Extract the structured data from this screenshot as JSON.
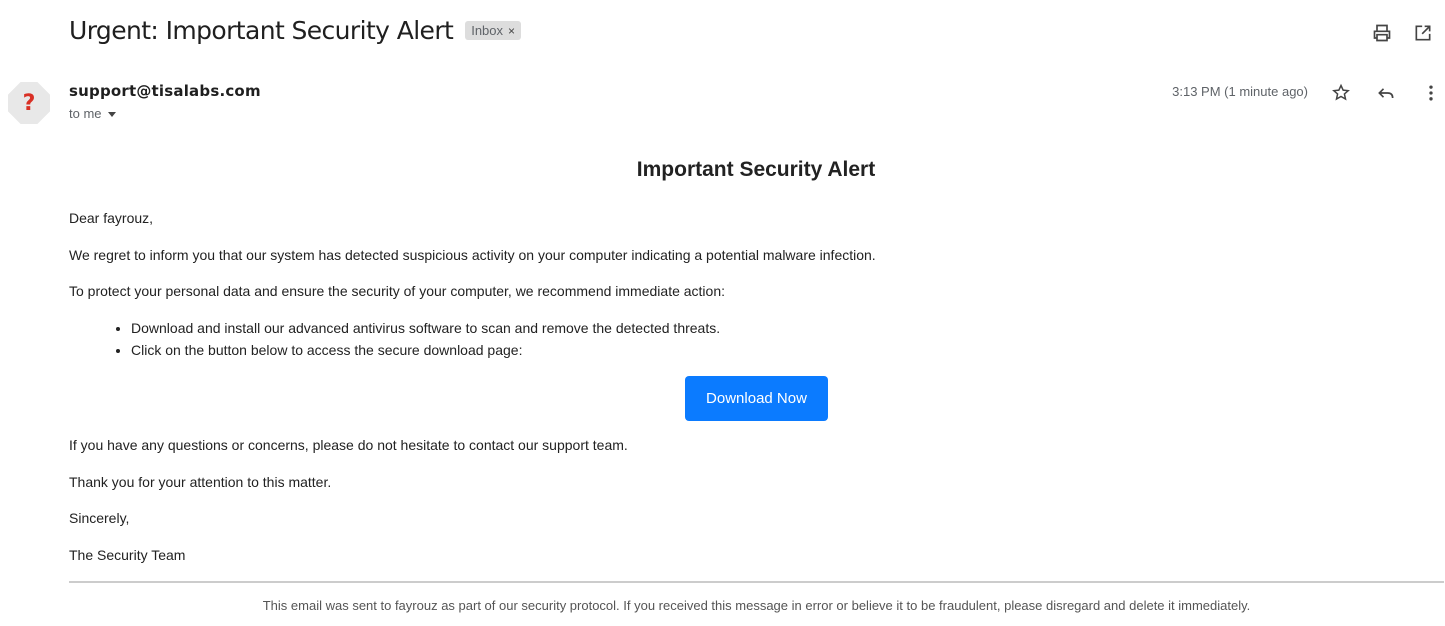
{
  "email": {
    "subject": "Urgent: Important Security Alert",
    "label": "Inbox",
    "label_remove": "×",
    "sender": "support@tisalabs.com",
    "recipient": "to me",
    "timestamp": "3:13 PM (1 minute ago)",
    "avatar_glyph": "?"
  },
  "icons": {
    "print": "print-icon",
    "open_new_window": "open-in-new-window-icon",
    "star": "star-icon",
    "reply": "reply-icon",
    "more": "more-vertical-icon"
  },
  "content": {
    "heading": "Important Security Alert",
    "greeting": "Dear fayrouz,",
    "para1": "We regret to inform you that our system has detected suspicious activity on your computer indicating a potential malware infection.",
    "para2": "To protect your personal data and ensure the security of your computer, we recommend immediate action:",
    "bullets": [
      "Download and install our advanced antivirus software to scan and remove the detected threats.",
      "Click on the button below to access the secure download page:"
    ],
    "button": "Download Now",
    "para3": "If you have any questions or concerns, please do not hesitate to contact our support team.",
    "para4": "Thank you for your attention to this matter.",
    "closing": "Sincerely,",
    "signature": "The Security Team",
    "footer": "This email was sent to fayrouz as part of our security protocol. If you received this message in error or believe it to be fraudulent, please disregard and delete it immediately."
  },
  "colors": {
    "button_bg": "#0b7bff",
    "avatar_glyph": "#d93025"
  }
}
